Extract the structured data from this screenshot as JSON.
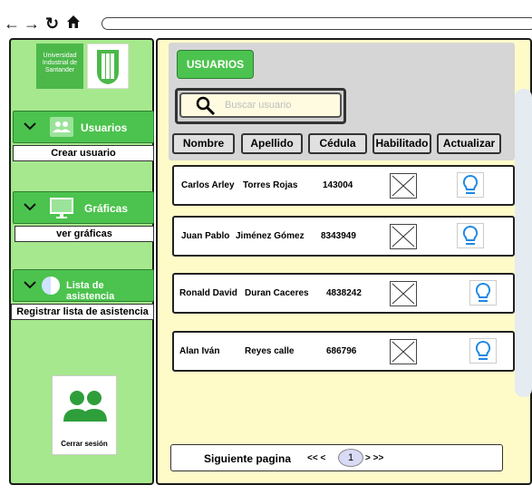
{
  "browser": {
    "back_icon": "arrow-left-icon",
    "forward_icon": "arrow-right-icon",
    "reload_icon": "reload-icon",
    "home_icon": "home-icon",
    "address": ""
  },
  "sidebar": {
    "logo_text": "Universidad Industrial de Santander",
    "sections": [
      {
        "title": "Usuarios",
        "action": "Crear usuario"
      },
      {
        "title": "Gráficas",
        "action": "ver gráficas"
      },
      {
        "title": "Lista de asistencia",
        "action": "Registrar lista de asistencia"
      }
    ],
    "logout_label": "Cerrar sesión"
  },
  "main": {
    "usuarios_button": "USUARIOS",
    "search_placeholder": "Buscar usuario",
    "columns": [
      "Nombre",
      "Apellido",
      "Cédula",
      "Habilitado",
      "Actualizar"
    ],
    "rows": [
      {
        "nombre": "Carlos Arley",
        "apellido": "Torres Rojas",
        "cedula": "143004"
      },
      {
        "nombre": "Juan Pablo",
        "apellido": "Jiménez Gómez",
        "cedula": "8343949"
      },
      {
        "nombre": "Ronald David",
        "apellido": "Duran Caceres",
        "cedula": "4838242"
      },
      {
        "nombre": "Alan Iván",
        "apellido": "Reyes calle",
        "cedula": "686796"
      }
    ],
    "pager": {
      "next_label": "Siguiente pagina",
      "prev_arrows": "<< <",
      "current_page": "1",
      "next_arrows": "> >>"
    }
  },
  "colors": {
    "sidebar_bg": "#a6e88d",
    "accent_green": "#4cc34e",
    "main_bg": "#fffbc9",
    "bulb_blue": "#1e88e5"
  }
}
